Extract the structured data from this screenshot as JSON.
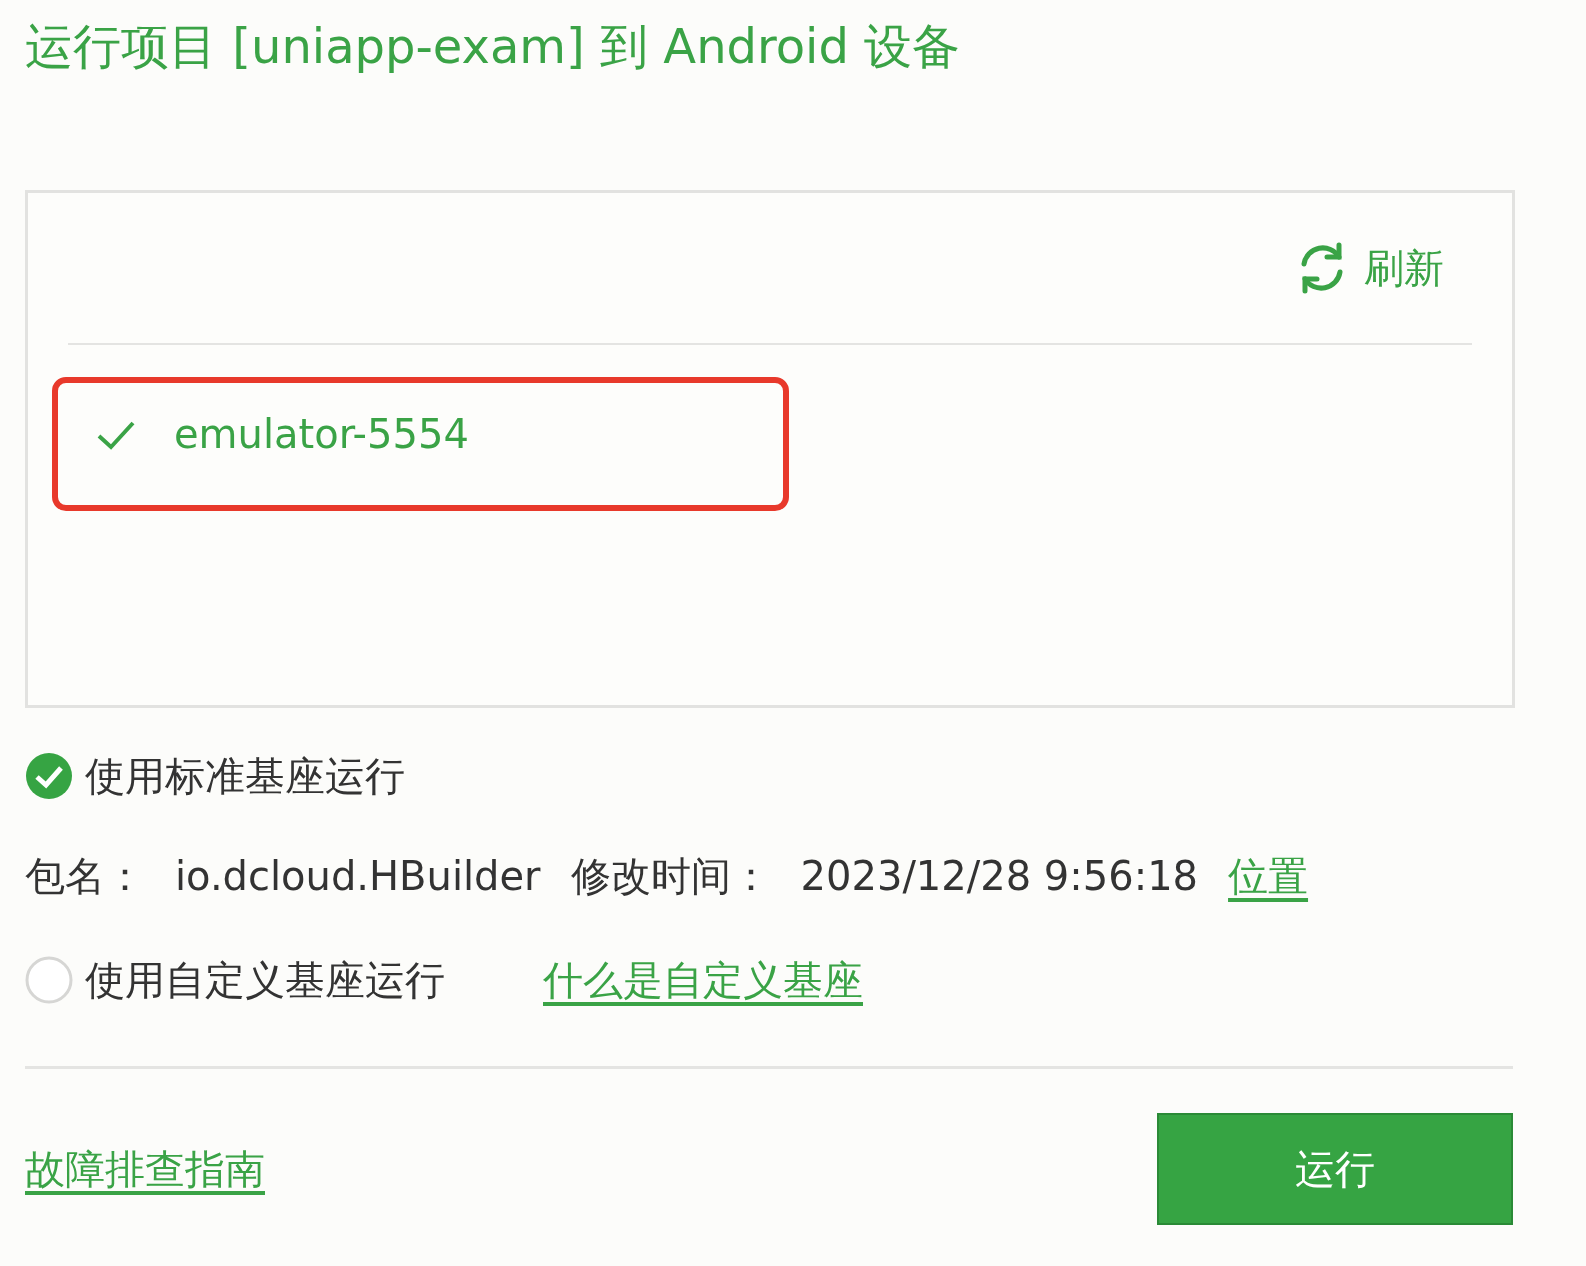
{
  "title": "运行项目 [uniapp-exam] 到 Android 设备",
  "refresh": {
    "label": "刷新"
  },
  "devices": [
    {
      "name": "emulator-5554",
      "selected": true,
      "highlighted": true
    }
  ],
  "options": [
    {
      "label": "使用标准基座运行",
      "selected": true
    },
    {
      "label": "使用自定义基座运行",
      "selected": false,
      "link": "什么是自定义基座"
    }
  ],
  "package_info": {
    "name_label": "包名：",
    "name": "io.dcloud.HBuilder",
    "time_label": "修改时间：",
    "time": "2023/12/28 9:56:18",
    "link": "位置"
  },
  "footer": {
    "help_link": "故障排查指南",
    "run_button": "运行"
  }
}
